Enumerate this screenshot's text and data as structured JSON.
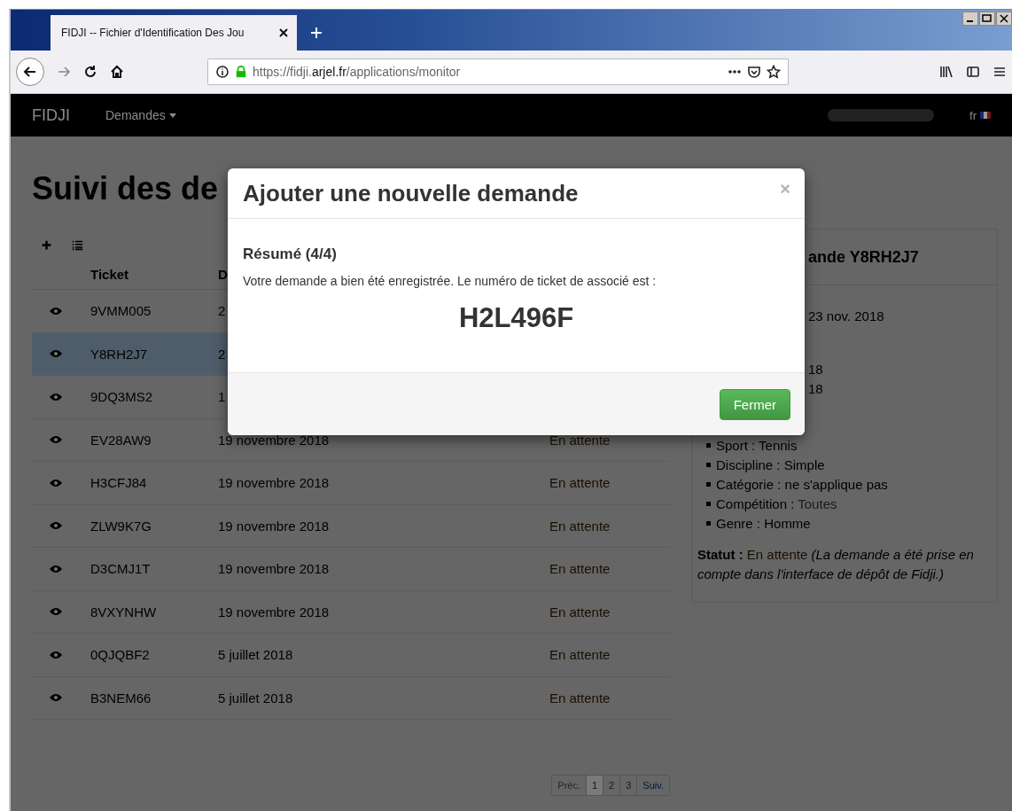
{
  "browser": {
    "tab": {
      "title": "FIDJI -- Fichier d'Identification Des Jou",
      "selected": true
    },
    "address": {
      "scheme": "https://fidji.",
      "domain": "arjel.fr",
      "path": "/applications/monitor"
    }
  },
  "navbar": {
    "brand": "FIDJI",
    "menu": "Demandes",
    "language": "fr"
  },
  "page": {
    "title": "Suivi des de",
    "table": {
      "columns": [
        "Ticket",
        "D"
      ],
      "rows": [
        {
          "ticket": "9VMM005",
          "date": "2",
          "selected": false
        },
        {
          "ticket": "Y8RH2J7",
          "date": "2",
          "selected": true
        },
        {
          "ticket": "9DQ3MS2",
          "date": "1",
          "selected": false
        },
        {
          "ticket": "EV28AW9",
          "date": "19 novembre 2018",
          "status": "En attente",
          "selected": false
        },
        {
          "ticket": "H3CFJ84",
          "date": "19 novembre 2018",
          "status": "En attente",
          "selected": false
        },
        {
          "ticket": "ZLW9K7G",
          "date": "19 novembre 2018",
          "status": "En attente",
          "selected": false
        },
        {
          "ticket": "D3CMJ1T",
          "date": "19 novembre 2018",
          "status": "En attente",
          "selected": false
        },
        {
          "ticket": "8VXYNHW",
          "date": "19 novembre 2018",
          "status": "En attente",
          "selected": false
        },
        {
          "ticket": "0QJQBF2",
          "date": "5 juillet 2018",
          "status": "En attente",
          "selected": false
        },
        {
          "ticket": "B3NEM66",
          "date": "5 juillet 2018",
          "status": "En attente",
          "selected": false
        }
      ]
    },
    "pagination": [
      {
        "label": "Préc.",
        "disabled": true,
        "selected": false
      },
      {
        "label": "1",
        "disabled": false,
        "selected": true
      },
      {
        "label": "2",
        "disabled": false,
        "selected": false
      },
      {
        "label": "3",
        "disabled": false,
        "selected": false
      },
      {
        "label": "Suiv.",
        "disabled": false,
        "selected": false
      }
    ],
    "detail": {
      "title": "ande Y8RH2J7",
      "lines": [
        "23 nov. 2018",
        "18",
        "18"
      ],
      "criteria": [
        {
          "label": "Sport : ",
          "value": "Tennis",
          "kind": "text"
        },
        {
          "label": "Discipline : ",
          "value": "Simple",
          "kind": "text"
        },
        {
          "label": "Catégorie : ",
          "value": "ne s'applique pas",
          "kind": "text"
        },
        {
          "label": "Compétition : ",
          "value": "Toutes",
          "kind": "link"
        },
        {
          "label": "Genre : ",
          "value": "Homme",
          "kind": "text"
        }
      ],
      "status": {
        "label": "Statut :",
        "value": "En attente",
        "note": "(La demande a été prise en compte dans l'interface de dépôt de Fidji.)"
      }
    }
  },
  "modal": {
    "title": "Ajouter une nouvelle demande",
    "close": "×",
    "step": "Résumé (4/4)",
    "message": "Votre demande a bien été enregistrée. Le numéro de ticket de associé est :",
    "ticket": "H2L496F",
    "button": "Fermer"
  }
}
